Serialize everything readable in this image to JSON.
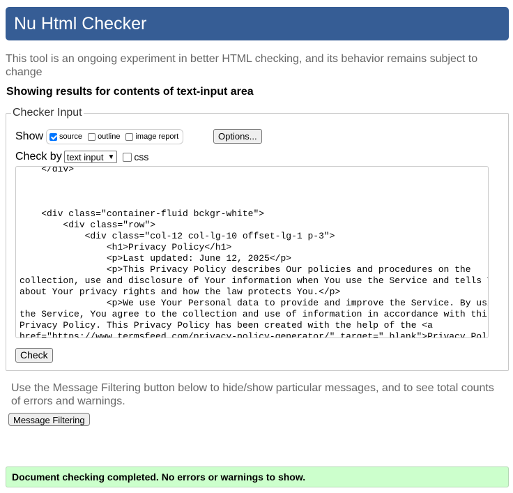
{
  "header": {
    "title": "Nu Html Checker"
  },
  "intro": "This tool is an ongoing experiment in better HTML checking, and its behavior remains subject to change",
  "results_heading": "Showing results for contents of text-input area",
  "checker": {
    "legend": "Checker Input",
    "show_label": "Show",
    "show_options": [
      {
        "label": "source",
        "checked": true
      },
      {
        "label": "outline",
        "checked": false
      },
      {
        "label": "image report",
        "checked": false
      }
    ],
    "options_button": "Options...",
    "check_by_label": "Check by",
    "check_by_value": "text input",
    "css_label": "css",
    "css_checked": false,
    "code_lines": [
      "    </div>",
      "",
      "",
      "",
      "    <div class=\"container-fluid bckgr-white\">",
      "        <div class=\"row\">",
      "            <div class=\"col-12 col-lg-10 offset-lg-1 p-3\">",
      "                <h1>Privacy Policy</h1>",
      "                <p>Last updated: June 12, 2025</p>",
      "                <p>This Privacy Policy describes Our policies and procedures on the",
      "collection, use and disclosure of Your information when You use the Service and tells You",
      "about Your privacy rights and how the law protects You.</p>",
      "                <p>We use Your Personal data to provide and improve the Service. By using",
      "the Service, You agree to the collection and use of information in accordance with this",
      "Privacy Policy. This Privacy Policy has been created with the help of the <a",
      "href=\"https://www.termsfeed.com/privacy-policy-generator/\" target=\"_blank\">Privacy Policy"
    ],
    "check_button": "Check"
  },
  "filter_note": "Use the Message Filtering button below to hide/show particular messages, and to see total counts of errors and warnings.",
  "filter_button": "Message Filtering",
  "status": "Document checking completed. No errors or warnings to show.",
  "colors": {
    "header_bg": "#365d95",
    "status_bg": "#ccffcc"
  }
}
